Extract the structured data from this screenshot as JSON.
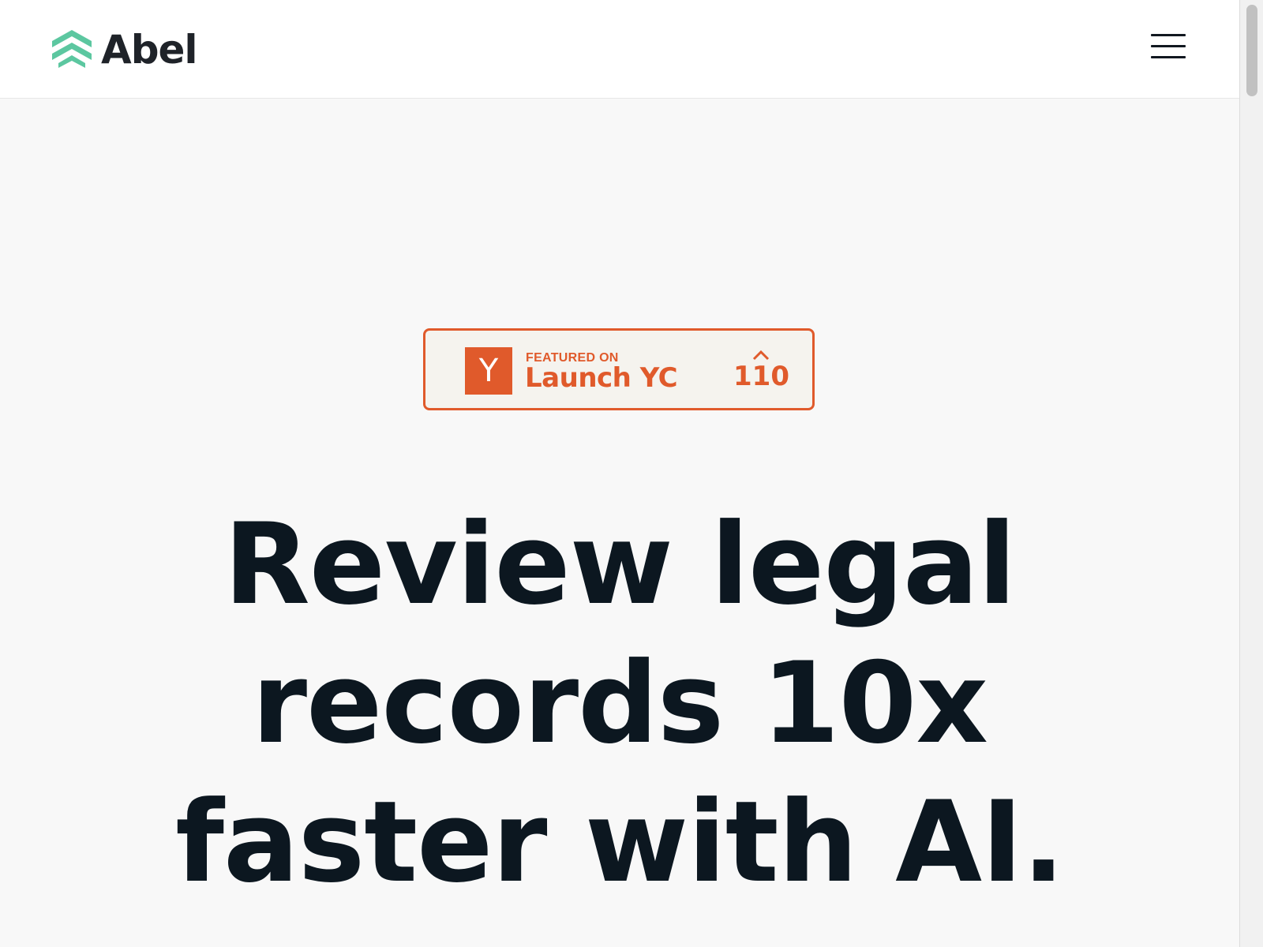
{
  "header": {
    "brand_name": "Abel",
    "logo_icon": "stacked-chevrons-logo",
    "menu_icon": "hamburger-menu-icon"
  },
  "badge": {
    "logo_letter": "Y",
    "featured_label": "FEATURED ON",
    "title": "Launch YC",
    "upvote_icon": "caret-up-icon",
    "upvote_count": "110"
  },
  "hero": {
    "title": "Review legal records 10x faster with AI."
  },
  "colors": {
    "brand_green": "#5cc7a0",
    "brand_text": "#1f2329",
    "yc_orange": "#e05a2b",
    "badge_bg": "#f5f3ee",
    "headline": "#0c1720",
    "page_bg": "#f8f8f8"
  }
}
